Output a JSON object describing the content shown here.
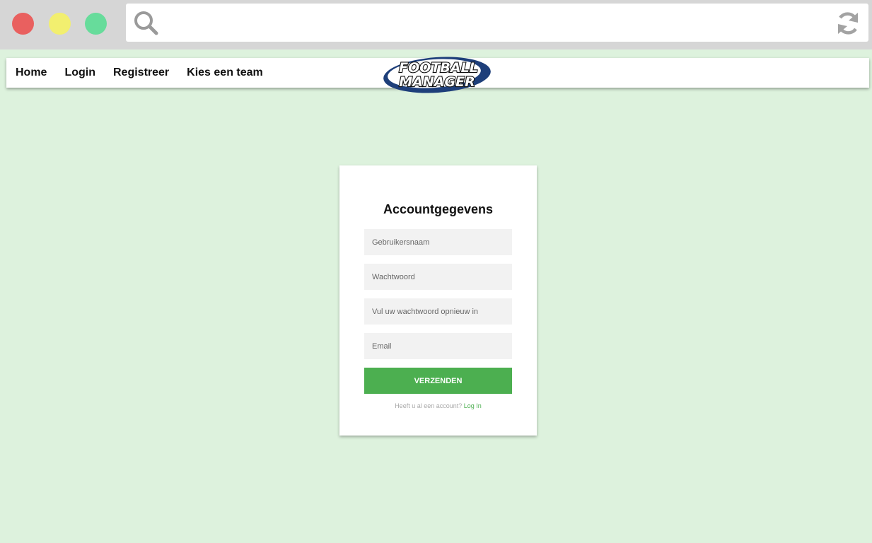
{
  "browser": {
    "url": "",
    "colors": {
      "close": "#e9605f",
      "minimize": "#f2ef6f",
      "maximize": "#67dc9b"
    }
  },
  "nav": {
    "links": [
      "Home",
      "Login",
      "Registreer",
      "Kies een team"
    ],
    "logo": {
      "line1": "FOOTBALL",
      "line2": "MANAGER"
    }
  },
  "form": {
    "title": "Accountgegevens",
    "fields": {
      "username_placeholder": "Gebruikersnaam",
      "password_placeholder": "Wachtwoord",
      "password_repeat_placeholder": "Vul uw wachtwoord opnieuw in",
      "email_placeholder": "Email"
    },
    "submit_label": "VERZENDEN",
    "footer_text": "Heeft u al een account?",
    "footer_link": "Log In"
  },
  "colors": {
    "page_bg": "#ddf2dd",
    "accent": "#4caf50"
  }
}
